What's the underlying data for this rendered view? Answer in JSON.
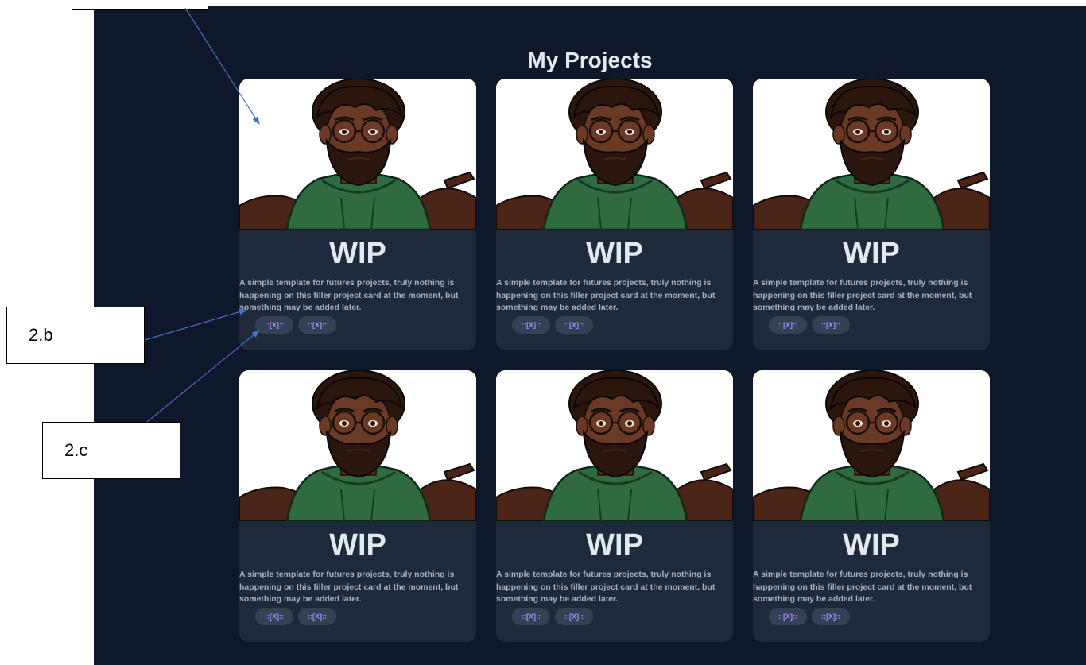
{
  "page": {
    "title": "My Projects"
  },
  "cards": [
    {
      "title": "WIP",
      "description": "A simple template for futures projects, truly nothing is happening on this filler project card at the moment, but something may be added later.",
      "tags": [
        "::[X]::",
        "::[X]::"
      ]
    },
    {
      "title": "WIP",
      "description": "A simple template for futures projects, truly nothing is happening on this filler project card at the moment, but something may be added later.",
      "tags": [
        "::[X]::",
        "::[X]::"
      ]
    },
    {
      "title": "WIP",
      "description": "A simple template for futures projects, truly nothing is happening on this filler project card at the moment, but something may be added later.",
      "tags": [
        "::[X]::",
        "::[X]::"
      ]
    },
    {
      "title": "WIP",
      "description": "A simple template for futures projects, truly nothing is happening on this filler project card at the moment, but something may be added later.",
      "tags": [
        "::[X]::",
        "::[X]::"
      ]
    },
    {
      "title": "WIP",
      "description": "A simple template for futures projects, truly nothing is happening on this filler project card at the moment, but something may be added later.",
      "tags": [
        "::[X]::",
        "::[X]::"
      ]
    },
    {
      "title": "WIP",
      "description": "A simple template for futures projects, truly nothing is happening on this filler project card at the moment, but something may be added later.",
      "tags": [
        "::[X]::",
        "::[X]::"
      ]
    }
  ],
  "annotations": {
    "label_b": "2.b",
    "label_c": "2.c"
  },
  "colors": {
    "page_background": "#0f172a",
    "card_background": "#1e293b",
    "tag_background": "#334155",
    "tag_text": "#a78bfa",
    "title_text": "#e2e8f0",
    "annotation_arrow": "#4472c4"
  },
  "icons": {
    "card_image": "cartoon-avatar-shrug-image"
  }
}
